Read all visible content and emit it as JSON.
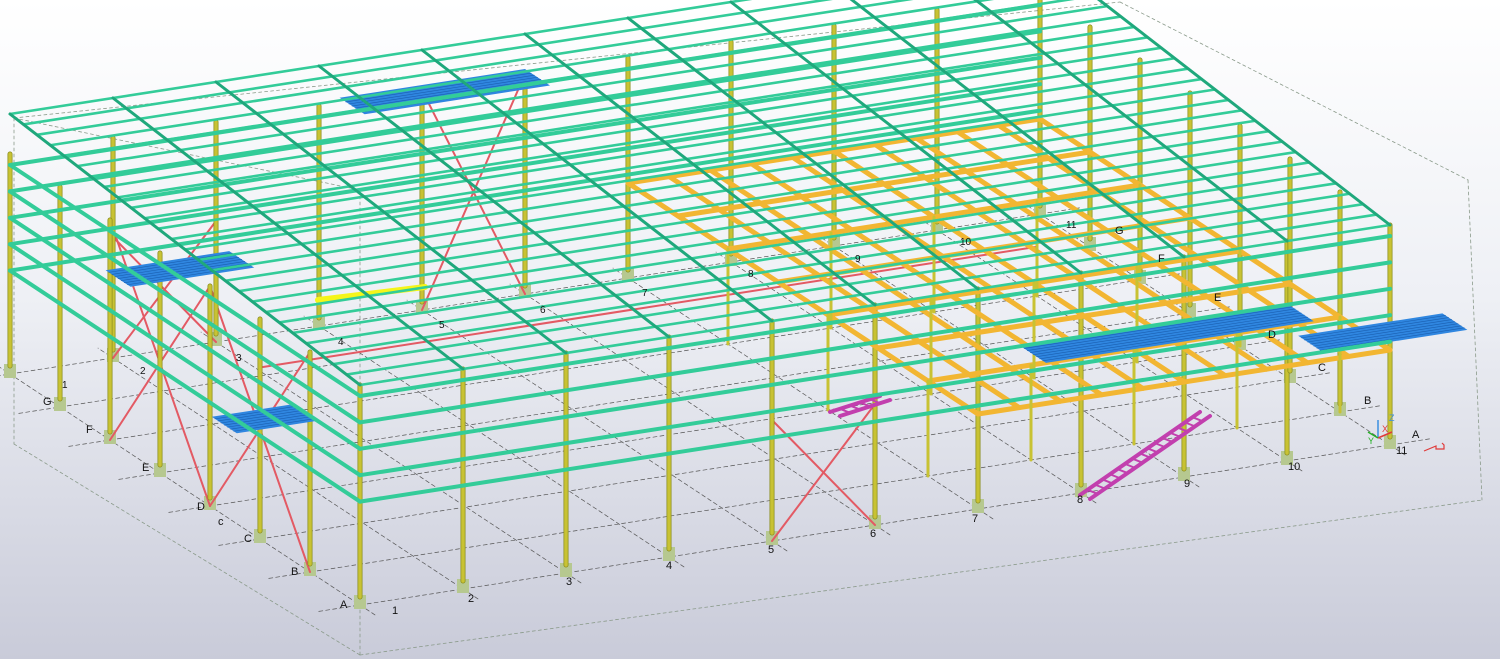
{
  "model": {
    "colors": {
      "roof_purlin": "#33cc99",
      "column": "#c8c233",
      "column_dark": "#8b8e1f",
      "brace": "#e35a64",
      "floor_beam": "#f2b632",
      "grating": "#2f86e0",
      "stair": "#c23fae",
      "base_plate": "#b6c890",
      "highlight": "#f5f51a",
      "grid_line": "#555555",
      "bbox_line": "#8a9a8a"
    },
    "grid_labels": {
      "rows_left": [
        "A",
        "B",
        "C",
        "c",
        "D",
        "E",
        "F",
        "G"
      ],
      "cols_front": [
        "1",
        "2",
        "3",
        "4",
        "5",
        "6",
        "7",
        "8",
        "9",
        "10",
        "11"
      ],
      "rows_right": [
        "A",
        "B",
        "C",
        "D",
        "E",
        "F",
        "G"
      ],
      "cols_back": [
        "1",
        "2",
        "3",
        "4",
        "5",
        "6",
        "7",
        "8",
        "9",
        "10",
        "11"
      ]
    },
    "axis_triad": {
      "x": "X",
      "y": "Y",
      "z": "Z"
    }
  }
}
